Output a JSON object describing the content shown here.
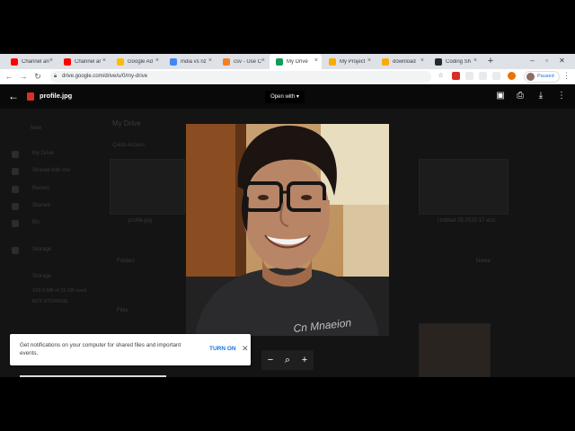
{
  "browser": {
    "tabs": [
      {
        "title": "Channel an",
        "favicon": "youtube-icon",
        "color": "#ff0000"
      },
      {
        "title": "Channel ar",
        "favicon": "youtube-icon",
        "color": "#ff0000"
      },
      {
        "title": "Google Ad",
        "favicon": "google-ads-icon",
        "color": "#fbbc04"
      },
      {
        "title": "India vs nz",
        "favicon": "google-icon",
        "color": "#4285f4"
      },
      {
        "title": "csv - Use C",
        "favicon": "stackoverflow-icon",
        "color": "#f48024"
      },
      {
        "title": "My Drive",
        "favicon": "google-drive-icon",
        "color": "#0f9d58",
        "active": true
      },
      {
        "title": "My Project",
        "favicon": "colab-icon",
        "color": "#f9ab00"
      },
      {
        "title": "download",
        "favicon": "colab-icon",
        "color": "#f9ab00"
      },
      {
        "title": "Coding Sh",
        "favicon": "github-icon",
        "color": "#24292e"
      }
    ],
    "new_tab_label": "+",
    "url": "drive.google.com/drive/u/0/my-drive",
    "profile_status": "Paused"
  },
  "viewer": {
    "file_name": "profile.jpg",
    "open_with_label": "Open with",
    "zoom_out_label": "−",
    "zoom_in_label": "+"
  },
  "notification": {
    "message": "Get notifications on your computer for shared files and important events.",
    "action_label": "TURN ON"
  },
  "drive_background": {
    "new_label": "New",
    "title": "My Drive",
    "quick_access": "Quick Access",
    "sidebar": [
      "My Drive",
      "Shared with me",
      "Recent",
      "Starred",
      "Bin"
    ],
    "storage_label": "Storage",
    "storage_used": "103.9 MB of 15 GB used",
    "buy_storage": "BUY STORAGE",
    "folders_label": "Folders",
    "files_label": "Files",
    "name_label": "Name",
    "file_left": "profile.jpg",
    "file_right": "Untitled 25-2020 17.xlsx"
  }
}
